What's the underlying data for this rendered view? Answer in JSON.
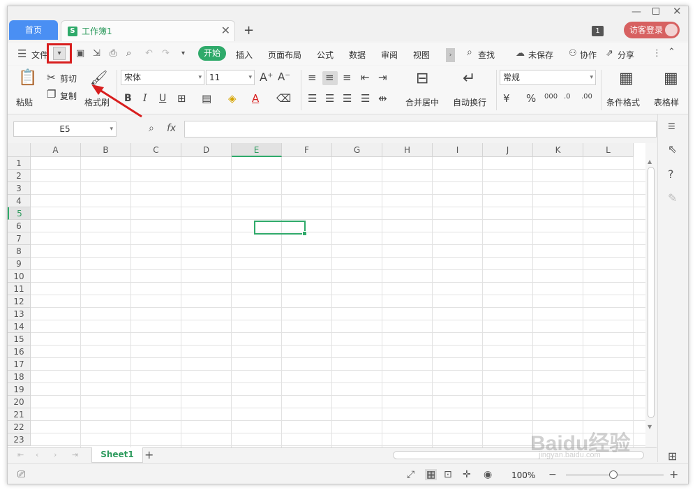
{
  "titlebar": {
    "home_tab": "首页",
    "doc_tab": "工作簿1",
    "doc_tab_icon": "S",
    "close": "✕",
    "add": "+",
    "count_badge": "1",
    "login": "访客登录"
  },
  "menubar": {
    "file": "文件",
    "tabs": [
      "开始",
      "插入",
      "页面布局",
      "公式",
      "数据",
      "审阅",
      "视图"
    ],
    "search": "查找",
    "unsaved": "未保存",
    "collab": "协作",
    "share": "分享"
  },
  "ribbon": {
    "paste": "粘贴",
    "cut": "剪切",
    "copy": "复制",
    "format_painter": "格式刷",
    "font_name": "宋体",
    "font_size": "11",
    "merge_center": "合并居中",
    "auto_wrap": "自动换行",
    "number_format": "常规",
    "percent": "%",
    "conditional_format": "条件格式",
    "table_style": "表格样"
  },
  "formulabar": {
    "name_box": "E5",
    "fx": "fx",
    "formula": ""
  },
  "grid": {
    "columns": [
      "A",
      "B",
      "C",
      "D",
      "E",
      "F",
      "G",
      "H",
      "I",
      "J",
      "K",
      "L"
    ],
    "rows": [
      "1",
      "2",
      "3",
      "4",
      "5",
      "6",
      "7",
      "8",
      "9",
      "10",
      "11",
      "12",
      "13",
      "14",
      "15",
      "16",
      "17",
      "18",
      "19",
      "20",
      "21",
      "22",
      "23"
    ],
    "active_col": "E",
    "active_row": "5"
  },
  "sheetbar": {
    "sheet_tab": "Sheet1",
    "add": "+"
  },
  "statusbar": {
    "zoom": "100%",
    "zoom_out": "−",
    "zoom_in": "+"
  },
  "watermark": {
    "main": "Baidu经验",
    "sub": "jingyan.baidu.com"
  },
  "colors": {
    "accent_green": "#2faa6a",
    "home_tab_blue": "#4a8ff3",
    "login_red": "#d76161",
    "annotation_red": "#d81e1e"
  }
}
